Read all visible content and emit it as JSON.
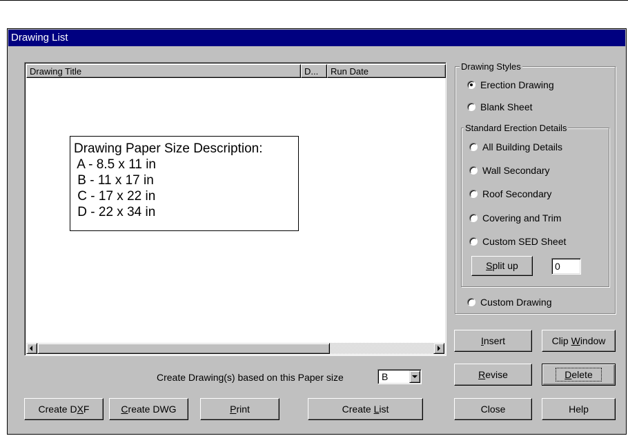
{
  "window": {
    "title": "Drawing List"
  },
  "list": {
    "columns": [
      {
        "label": "Drawing Title"
      },
      {
        "label": "D..."
      },
      {
        "label": "Run Date"
      }
    ]
  },
  "paper_note": {
    "lines": [
      "Drawing Paper Size Description:",
      " A - 8.5 x 11 in",
      " B - 11 x 17 in",
      " C - 17 x 22 in",
      " D - 22 x 34 in"
    ]
  },
  "paper_size": {
    "label": "Create Drawing(s) based on this Paper size",
    "value": "B"
  },
  "bottom_buttons": {
    "create_dxf": {
      "pre": "Create D",
      "key": "X",
      "post": "F"
    },
    "create_dwg": {
      "pre": "",
      "key": "C",
      "post": "reate DWG"
    },
    "print": {
      "pre": "",
      "key": "P",
      "post": "rint"
    },
    "create_list": {
      "pre": "Create ",
      "key": "L",
      "post": "ist"
    }
  },
  "styles": {
    "group_label": "Drawing Styles",
    "erection_drawing": "Erection Drawing",
    "blank_sheet": "Blank Sheet",
    "sed_group_label": "Standard Erection Details",
    "all_building": "All Building Details",
    "wall_secondary": "Wall Secondary",
    "roof_secondary": "Roof Secondary",
    "covering_trim": "Covering and Trim",
    "custom_sed": "Custom SED Sheet",
    "split_up": {
      "pre": "",
      "key": "S",
      "post": "plit up"
    },
    "split_value": "0",
    "custom_drawing": "Custom Drawing",
    "selected": "Erection Drawing"
  },
  "right_buttons": {
    "insert": {
      "pre": "",
      "key": "I",
      "post": "nsert"
    },
    "clip_window": {
      "pre": "Clip ",
      "key": "W",
      "post": "indow"
    },
    "revise": {
      "pre": "",
      "key": "R",
      "post": "evise"
    },
    "delete": {
      "pre": "",
      "key": "D",
      "post": "elete"
    },
    "close": "Close",
    "help": "Help"
  }
}
